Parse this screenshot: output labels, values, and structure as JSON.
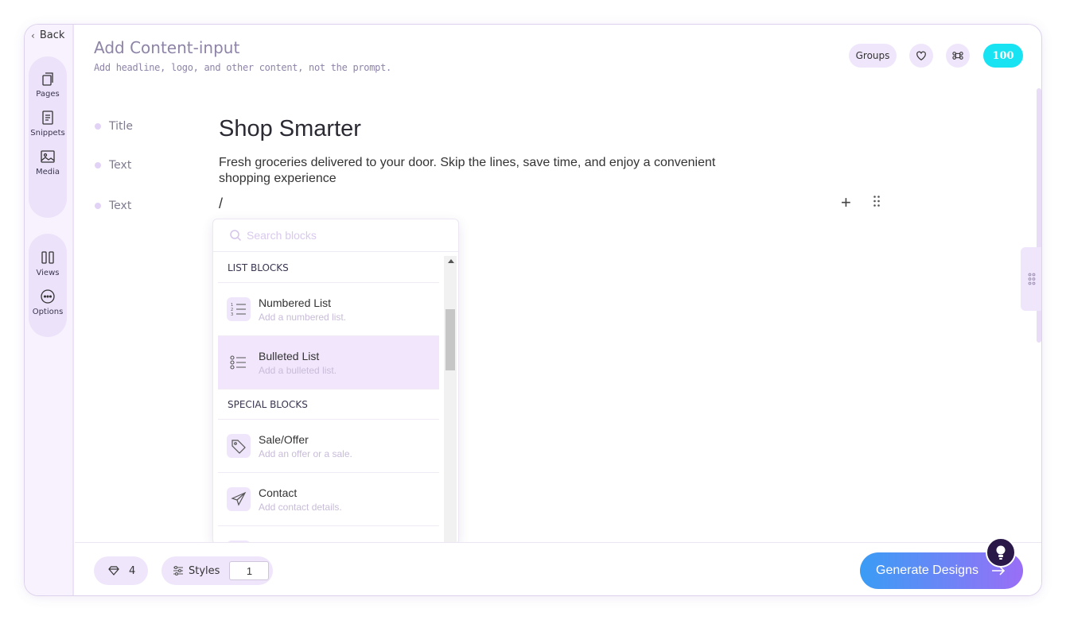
{
  "sidebar": {
    "back_label": "Back",
    "groups": [
      [
        {
          "label": "Pages",
          "icon": "pages-icon"
        },
        {
          "label": "Snippets",
          "icon": "snippets-icon"
        },
        {
          "label": "Media",
          "icon": "media-icon"
        }
      ],
      [
        {
          "label": "Views",
          "icon": "views-icon"
        },
        {
          "label": "Options",
          "icon": "options-icon"
        }
      ]
    ]
  },
  "header": {
    "title": "Add Content-input",
    "subtitle": "Add headline, logo, and other content, not the prompt.",
    "groups_label": "Groups",
    "credits": "100"
  },
  "rows": [
    {
      "label": "Title"
    },
    {
      "label": "Text"
    },
    {
      "label": "Text"
    }
  ],
  "content": {
    "heading": "Shop Smarter",
    "paragraph": "Fresh groceries delivered to your door. Skip the lines, save time, and enjoy a convenient shopping experience",
    "slash": "/"
  },
  "dropdown": {
    "search_placeholder": "Search blocks",
    "sections": [
      {
        "title": "LIST BLOCKS",
        "items": [
          {
            "name": "Numbered List",
            "desc": "Add a numbered list.",
            "icon": "numbered-list-icon"
          },
          {
            "name": "Bulleted List",
            "desc": "Add a bulleted list.",
            "icon": "bulleted-list-icon",
            "selected": true
          }
        ]
      },
      {
        "title": "SPECIAL BLOCKS",
        "items": [
          {
            "name": "Sale/Offer",
            "desc": "Add an offer or a sale.",
            "icon": "tag-icon"
          },
          {
            "name": "Contact",
            "desc": "Add contact details.",
            "icon": "send-icon"
          }
        ]
      }
    ]
  },
  "footer": {
    "diamond_count": "4",
    "styles_label": "Styles",
    "styles_value": "1",
    "generate_label": "Generate Designs"
  },
  "colors": {
    "accent": "#efe6fb",
    "credits_bg": "#18e3f3",
    "generate_start": "#3a9cf5",
    "generate_end": "#9a6ef6"
  }
}
